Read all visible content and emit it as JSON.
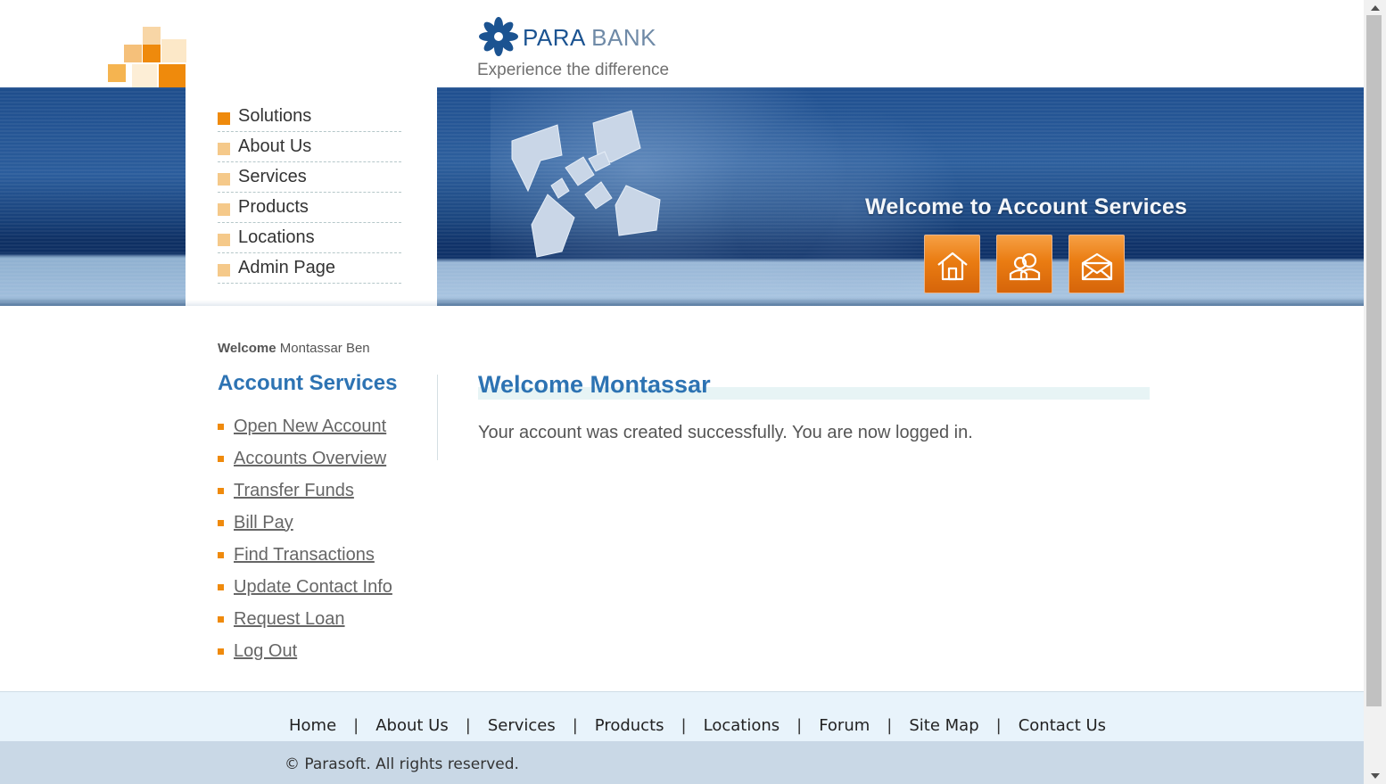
{
  "brand": {
    "name_part1": "PARA",
    "name_part2": "BANK",
    "tagline": "Experience the difference",
    "logo_icon": "pinwheel-icon"
  },
  "top_menu": {
    "items": [
      {
        "label": "Solutions",
        "active": true
      },
      {
        "label": "About Us",
        "active": false
      },
      {
        "label": "Services",
        "active": false
      },
      {
        "label": "Products",
        "active": false
      },
      {
        "label": "Locations",
        "active": false
      },
      {
        "label": "Admin Page",
        "active": false
      }
    ]
  },
  "header": {
    "banner_title": "Welcome to Account Services",
    "icons": [
      "home-icon",
      "people-icon",
      "envelope-icon"
    ]
  },
  "sidebar": {
    "welcome_label": "Welcome",
    "user_name": "Montassar Ben",
    "title": "Account Services",
    "links": [
      "Open New Account",
      "Accounts Overview",
      "Transfer Funds",
      "Bill Pay",
      "Find Transactions",
      "Update Contact Info",
      "Request Loan",
      "Log Out"
    ]
  },
  "main": {
    "title": "Welcome Montassar",
    "message": "Your account was created successfully. You are now logged in."
  },
  "footer": {
    "links": [
      "Home",
      "About Us",
      "Services",
      "Products",
      "Locations",
      "Forum",
      "Site Map",
      "Contact Us"
    ],
    "separator": "|",
    "copyright": "© Parasoft. All rights reserved."
  },
  "colors": {
    "accent_orange": "#ef8a0c",
    "title_blue": "#2d73b3",
    "header_blue": "#1e4d8c"
  }
}
